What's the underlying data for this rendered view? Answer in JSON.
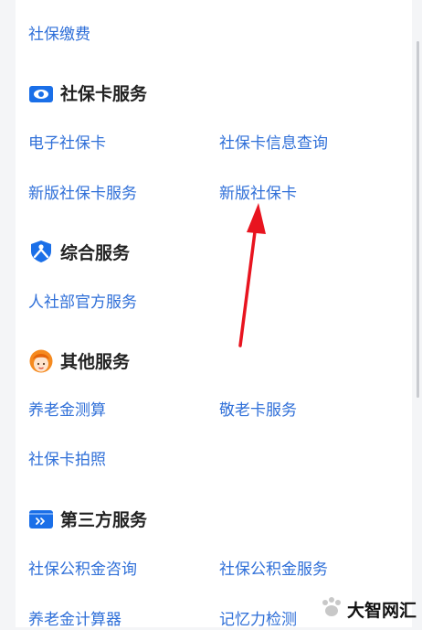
{
  "top_link": "社保缴费",
  "sections": [
    {
      "title": "社保卡服务",
      "icon": "eye-card-icon",
      "items": [
        "电子社保卡",
        "社保卡信息查询",
        "新版社保卡服务",
        "新版社保卡"
      ]
    },
    {
      "title": "综合服务",
      "icon": "person-shield-icon",
      "items": [
        "人社部官方服务"
      ]
    },
    {
      "title": "其他服务",
      "icon": "avatar-face-icon",
      "items": [
        "养老金测算",
        "敬老卡服务",
        "社保卡拍照"
      ]
    },
    {
      "title": "第三方服务",
      "icon": "forward-card-icon",
      "items": [
        "社保公积金咨询",
        "社保公积金服务",
        "养老金计算器",
        "记忆力检测"
      ]
    }
  ],
  "watermark": {
    "text": "大智网汇",
    "icon": "paw-icon"
  },
  "colors": {
    "link": "#2f6fd8",
    "arrow": "#e8141f",
    "icon_blue": "#1a6fe8",
    "icon_orange": "#f58a1f"
  }
}
